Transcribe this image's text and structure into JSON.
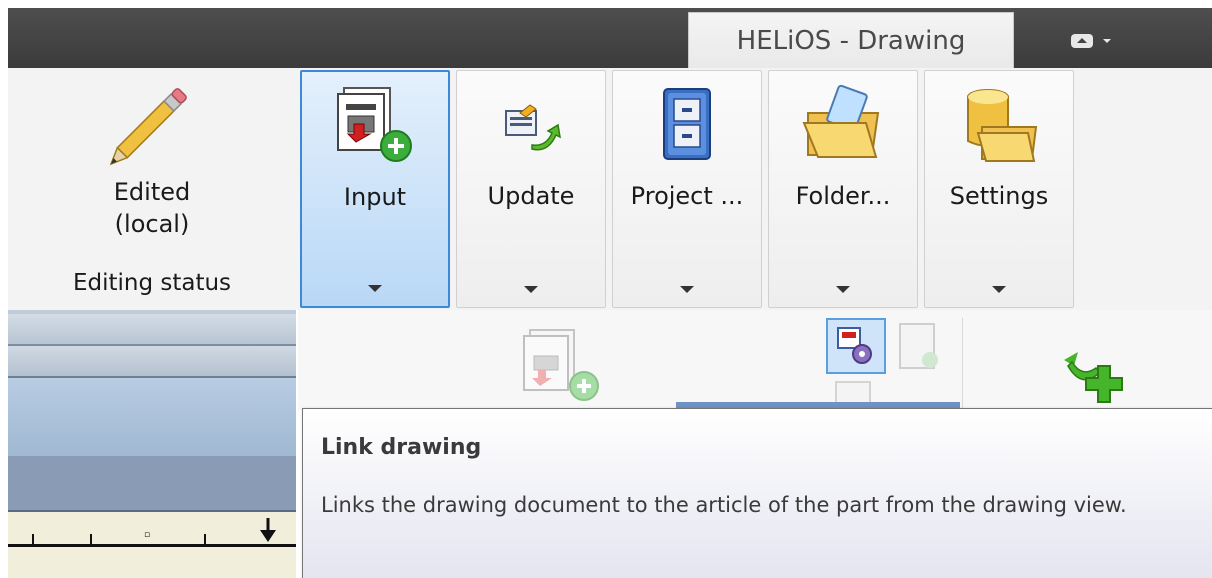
{
  "window": {
    "title": "HELiOS - Drawing"
  },
  "editing_status": {
    "value_line1": "Edited",
    "value_line2": "(local)",
    "group_label": "Editing status"
  },
  "ribbon": {
    "buttons": [
      {
        "label": "Input",
        "icon": "drawing-input-icon",
        "active": true
      },
      {
        "label": "Update",
        "icon": "update-icon",
        "active": false
      },
      {
        "label": "Project ...",
        "icon": "project-cabinet-icon",
        "active": false
      },
      {
        "label": "Folder...",
        "icon": "folder-icon",
        "active": false
      },
      {
        "label": "Settings",
        "icon": "settings-database-icon",
        "active": false
      }
    ]
  },
  "tooltip": {
    "title": "Link drawing",
    "body": "Links the drawing document to the article of the part from the drawing view."
  },
  "colors": {
    "active_border": "#3d88d8",
    "titlebar": "#444444",
    "accent_green": "#45b52c"
  }
}
